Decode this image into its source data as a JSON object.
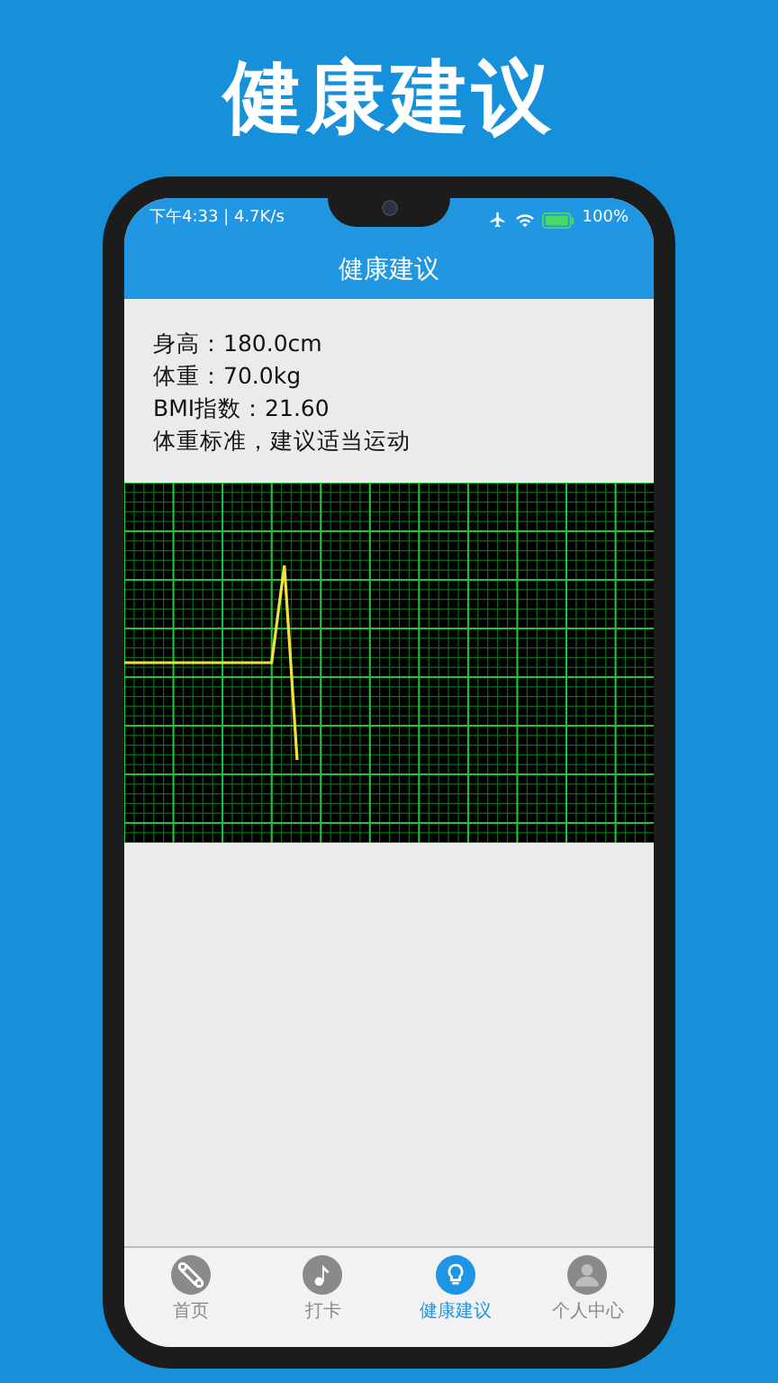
{
  "headline": "健康建议",
  "status_bar": {
    "time": "下午4:33 | 4.7K/s",
    "battery": "100%"
  },
  "app_bar": {
    "title": "健康建议"
  },
  "info_lines": [
    "身高：180.0cm",
    "体重：70.0kg",
    "BMI指数：21.60",
    "体重标准，建议适当运动"
  ],
  "bottom_nav": [
    {
      "kind": "home",
      "label": "首页",
      "selected": false
    },
    {
      "kind": "music",
      "label": "打卡",
      "selected": false
    },
    {
      "kind": "bulb",
      "label": "健康建议",
      "selected": true
    },
    {
      "kind": "person",
      "label": "个人中心",
      "selected": false
    }
  ]
}
